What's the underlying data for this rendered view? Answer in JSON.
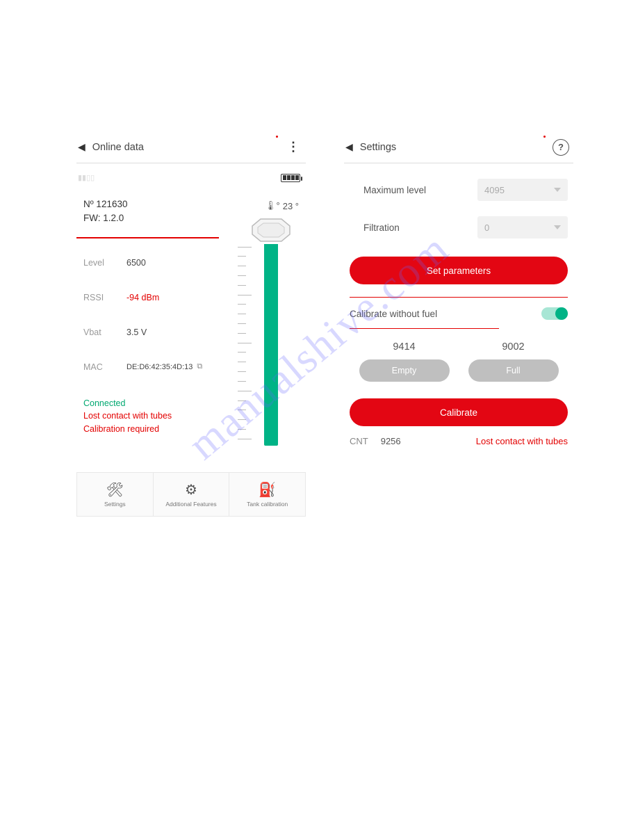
{
  "watermark": "manualshive.com",
  "left": {
    "title": "Online data",
    "device_number": "Nº 121630",
    "firmware": "FW: 1.2.0",
    "temperature": "23 °",
    "readings": {
      "level": {
        "label": "Level",
        "value": "6500"
      },
      "rssi": {
        "label": "RSSI",
        "value": "-94 dBm"
      },
      "vbat": {
        "label": "Vbat",
        "value": "3.5 V"
      },
      "mac": {
        "label": "MAC",
        "value": "DE:D6:42:35:4D:13"
      }
    },
    "status": {
      "connected": "Connected",
      "lost": "Lost contact with tubes",
      "calibration": "Calibration required"
    },
    "nav": {
      "settings": "Settings",
      "additional": "Additional Features",
      "tank": "Tank calibration"
    }
  },
  "right": {
    "title": "Settings",
    "max_level": {
      "label": "Maximum level",
      "value": "4095"
    },
    "filtration": {
      "label": "Filtration",
      "value": "0"
    },
    "set_parameters": "Set parameters",
    "calibrate_without_fuel": "Calibrate without fuel",
    "empty_value": "9414",
    "full_value": "9002",
    "empty_label": "Empty",
    "full_label": "Full",
    "calibrate": "Calibrate",
    "cnt_label": "CNT",
    "cnt_value": "9256",
    "cnt_error": "Lost contact with tubes"
  }
}
